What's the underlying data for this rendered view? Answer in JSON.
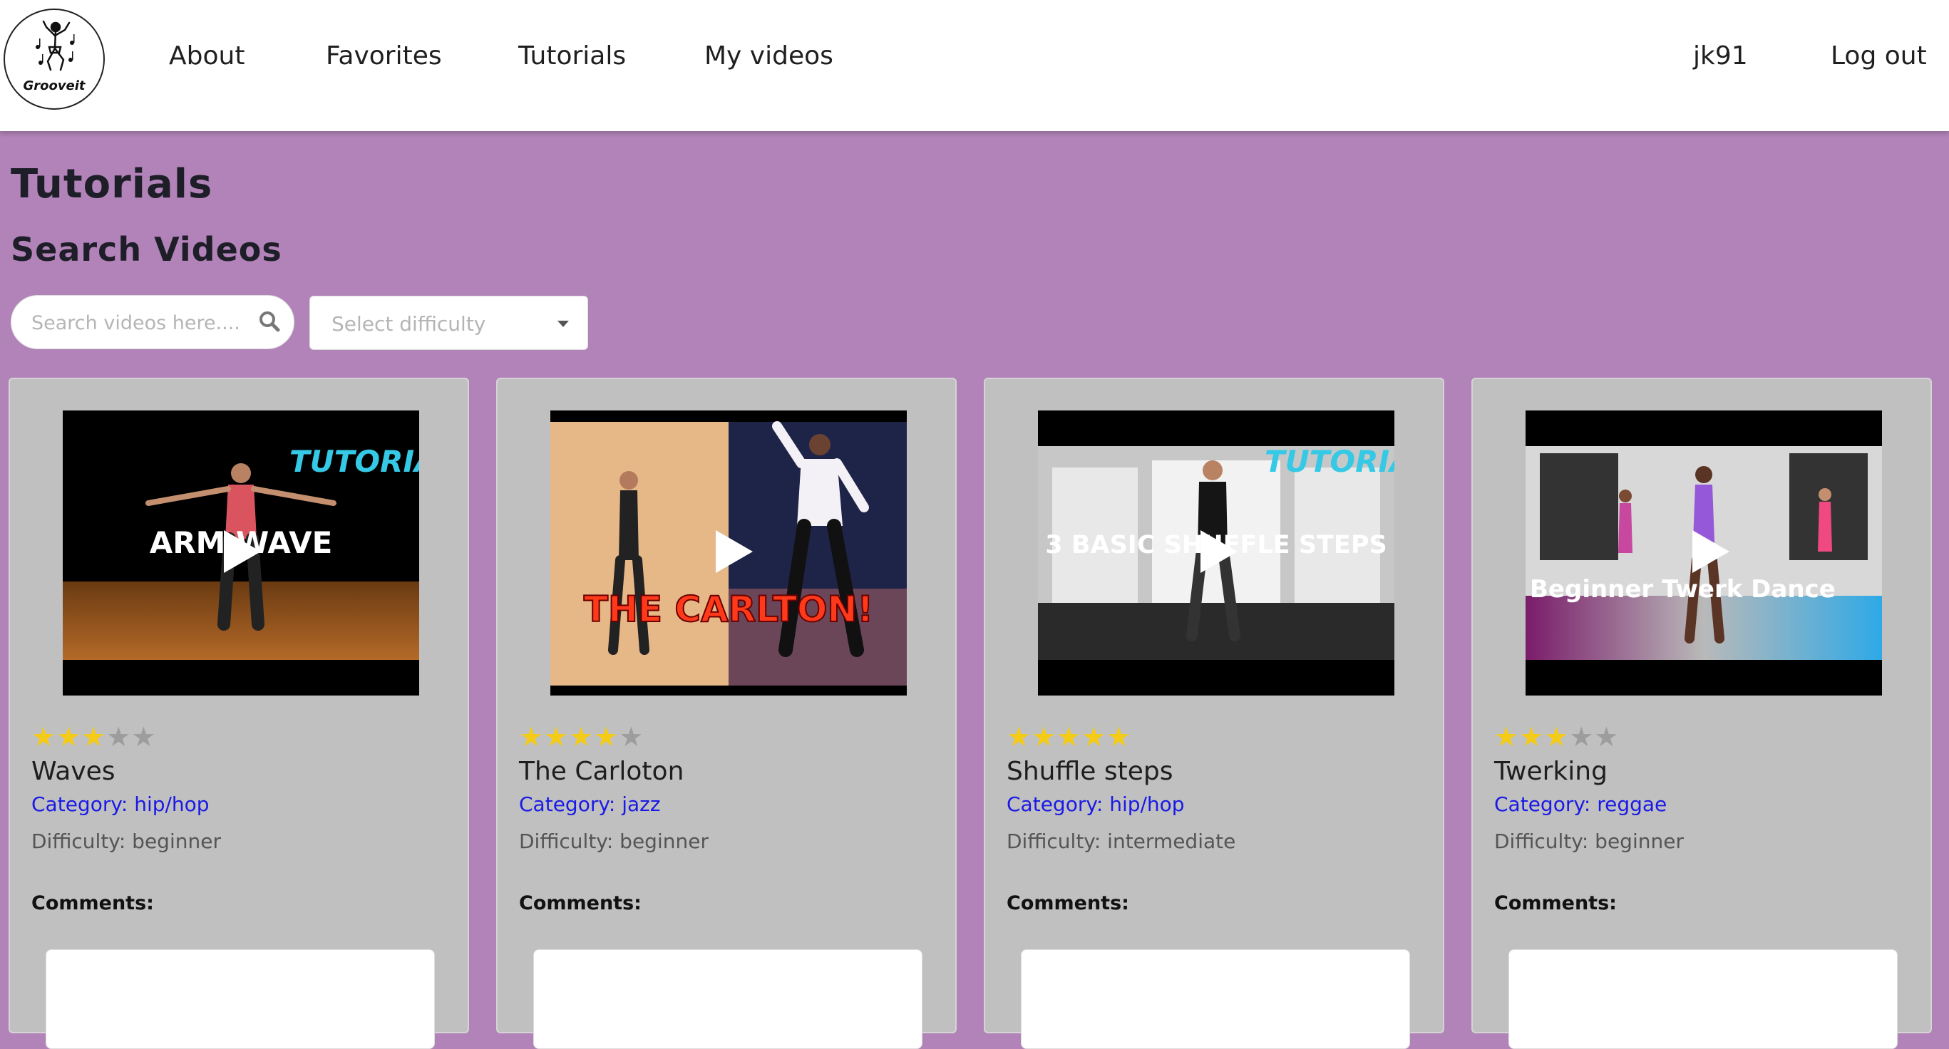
{
  "brand": {
    "logo_text": "Grooveit"
  },
  "nav": {
    "about": "About",
    "favorites": "Favorites",
    "tutorials": "Tutorials",
    "my_videos": "My videos",
    "username": "jk91",
    "logout": "Log out"
  },
  "page": {
    "title": "Tutorials",
    "search_heading": "Search Videos"
  },
  "search": {
    "placeholder": "Search videos here....",
    "difficulty_placeholder": "Select difficulty"
  },
  "colors": {
    "background": "#b283b9",
    "card": "#c0c0c0",
    "category_link": "#1a1ae6",
    "star_on": "#f4cc18",
    "star_off": "#9d9d9d"
  },
  "videos": [
    {
      "title": "Waves",
      "category": "Category: hip/hop",
      "difficulty": "Difficulty: beginner",
      "rating": 3,
      "thumb_text": "ARM WAVE",
      "thumb_tag": "TUTORIAL",
      "comments_label": "Comments:"
    },
    {
      "title": "The Carloton",
      "category": "Category: jazz",
      "difficulty": "Difficulty: beginner",
      "rating": 4,
      "thumb_text": "THE CARLTON!",
      "thumb_tag": "",
      "comments_label": "Comments:"
    },
    {
      "title": "Shuffle steps",
      "category": "Category: hip/hop",
      "difficulty": "Difficulty: intermediate",
      "rating": 5,
      "thumb_text": "3 BASIC SHUFFLE STEPS",
      "thumb_tag": "TUTORIAL",
      "comments_label": "Comments:"
    },
    {
      "title": "Twerking",
      "category": "Category: reggae",
      "difficulty": "Difficulty: beginner",
      "rating": 3,
      "thumb_text": "Beginner Twerk Dance",
      "thumb_tag": "",
      "comments_label": "Comments:"
    }
  ]
}
